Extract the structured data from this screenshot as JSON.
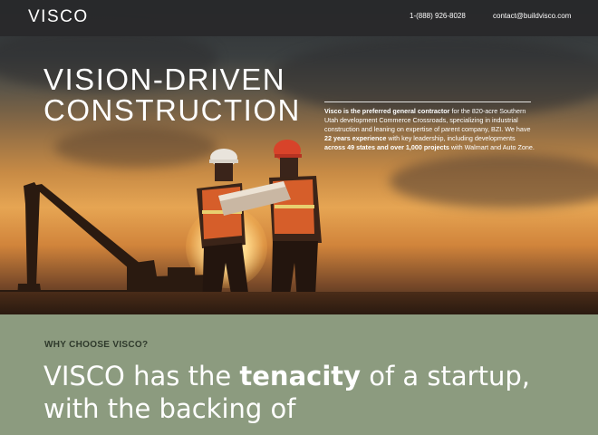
{
  "header": {
    "logo": "VISCO",
    "phone": "1-(888) 926-8028",
    "email": "contact@buildvisco.com"
  },
  "hero": {
    "title_line1": "VISION-DRIVEN",
    "title_line2": "CONSTRUCTION",
    "desc_lead_bold": "Visco is the preferred general contractor",
    "desc_mid1": " for the 820-acre Southern Utah development Commerce Crossroads, specializing in industrial construction and leaning on expertise of parent company, BZI. We have ",
    "desc_bold2": "22 years experience",
    "desc_mid2": " with key leadership, including developments ",
    "desc_bold3": "across 49 states and over 1,000 projects",
    "desc_end": " with Walmart and Auto Zone."
  },
  "why": {
    "eyebrow": "WHY CHOOSE VISCO?",
    "headline_pre": "VISCO has the ",
    "headline_bold": "tenacity",
    "headline_post": " of a startup, with the backing of"
  }
}
